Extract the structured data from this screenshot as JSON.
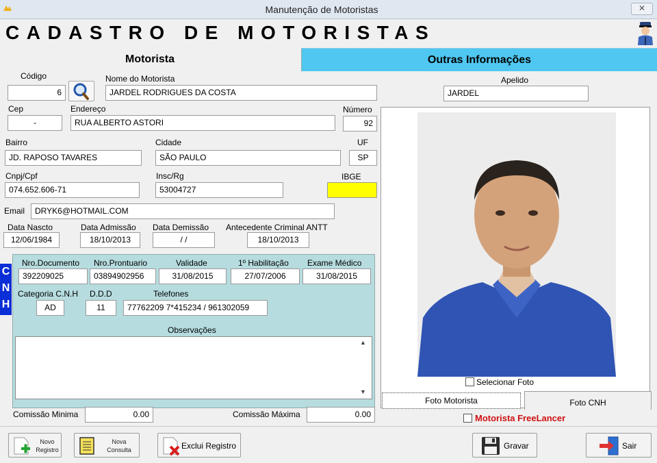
{
  "window": {
    "title": "Manutenção de Motoristas"
  },
  "heading": "CADASTRO DE MOTORISTAS",
  "tabs": {
    "active": "Motorista",
    "other": "Outras Informações"
  },
  "fields": {
    "codigo": {
      "label": "Código",
      "value": "6"
    },
    "nome": {
      "label": "Nome do Motorista",
      "value": "JARDEL RODRIGUES DA COSTA"
    },
    "apelido": {
      "label": "Apelido",
      "value": "JARDEL"
    },
    "cep": {
      "label": "Cep",
      "value": "-"
    },
    "endereco": {
      "label": "Endereço",
      "value": "RUA ALBERTO ASTORI"
    },
    "numero": {
      "label": "Número",
      "value": "92"
    },
    "bairro": {
      "label": "Bairro",
      "value": "JD. RAPOSO TAVARES"
    },
    "cidade": {
      "label": "Cidade",
      "value": "SÃO PAULO"
    },
    "uf": {
      "label": "UF",
      "value": "SP"
    },
    "cnpj": {
      "label": "Cnpj/Cpf",
      "value": "074.652.606-71"
    },
    "insc": {
      "label": "Insc/Rg",
      "value": "53004727"
    },
    "ibge": {
      "label": "IBGE",
      "value": ""
    },
    "email": {
      "label": "Email",
      "value": "DRYK6@HOTMAIL.COM"
    },
    "data_nasc": {
      "label": "Data Nascto",
      "value": "12/06/1984"
    },
    "data_adm": {
      "label": "Data Admissão",
      "value": "18/10/2013"
    },
    "data_dem": {
      "label": "Data Demissão",
      "value": " / /"
    },
    "antecedente": {
      "label": "Antecedente Criminal ANTT",
      "value": "18/10/2013"
    }
  },
  "cnh": {
    "strip_letters": [
      "C",
      "N",
      "H"
    ],
    "nro_documento": {
      "label": "Nro.Documento",
      "value": "392209025"
    },
    "nro_prontuario": {
      "label": "Nro.Prontuario",
      "value": "03894902956"
    },
    "validade": {
      "label": "Validade",
      "value": "31/08/2015"
    },
    "primeira_hab": {
      "label": "1º Habilitação",
      "value": "27/07/2006"
    },
    "exame_medico": {
      "label": "Exame Médico",
      "value": "31/08/2015"
    },
    "categoria": {
      "label": "Categoria C.N.H",
      "value": "AD"
    },
    "ddd": {
      "label": "D.D.D",
      "value": "11"
    },
    "telefones": {
      "label": "Telefones",
      "value": "77762209 7*415234 / 961302059"
    },
    "observacoes": {
      "label": "Observações",
      "value": ""
    }
  },
  "comissao": {
    "minima": {
      "label": "Comissão Minima",
      "value": "0.00"
    },
    "maxima": {
      "label": "Comissão Máxima",
      "value": "0.00"
    }
  },
  "photo": {
    "select_label": "Selecionar Foto",
    "tab_motorista": "Foto Motorista",
    "tab_cnh": "Foto CNH",
    "freelancer_label": "Motorista FreeLancer"
  },
  "buttons": {
    "novo_line1": "Novo",
    "novo_line2": "Registro",
    "consulta_line1": "Nova",
    "consulta_line2": "Consulta",
    "exclui": "Exclui Registro",
    "gravar": "Gravar",
    "sair": "Sair"
  },
  "colors": {
    "tab_blue": "#4fc7f0",
    "cnh_blue": "#0b2fd6",
    "cnh_panel": "#b6dcdf",
    "ibge_yellow": "#ffff00",
    "freelancer_red": "#d01010"
  }
}
